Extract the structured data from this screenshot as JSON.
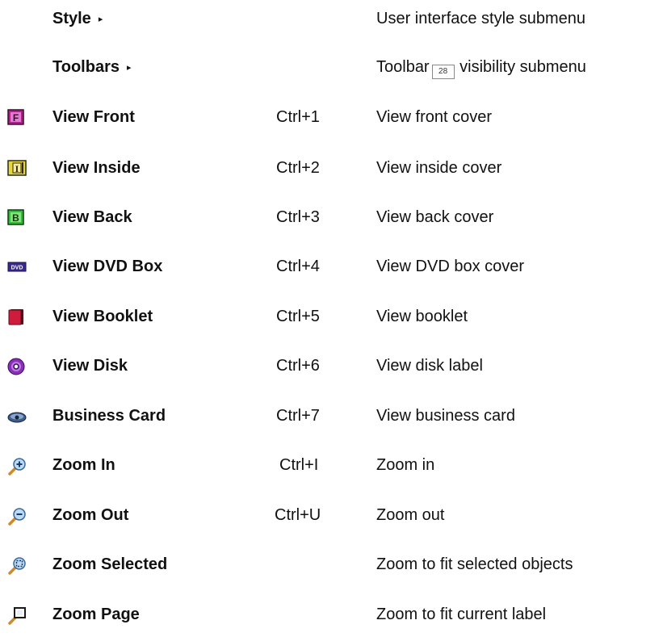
{
  "menu": {
    "items": [
      {
        "name": "Style",
        "arrow": "▸",
        "shortcut": "",
        "description": "User interface style submenu",
        "icon": "none"
      },
      {
        "name": "Toolbars",
        "arrow": "▸",
        "shortcut": "",
        "description_before": "Toolbar",
        "ref": "28",
        "description_after": " visibility submenu",
        "icon": "none"
      },
      {
        "name": "View Front",
        "shortcut": "Ctrl+1",
        "description": "View front cover",
        "icon": "front-cover-icon"
      },
      {
        "name": "View Inside",
        "shortcut": "Ctrl+2",
        "description": "View inside cover",
        "icon": "inside-cover-icon"
      },
      {
        "name": "View Back",
        "shortcut": "Ctrl+3",
        "description": "View back cover",
        "icon": "back-cover-icon"
      },
      {
        "name": "View DVD Box",
        "shortcut": "Ctrl+4",
        "description": "View DVD box cover",
        "icon": "dvd-box-icon",
        "icon_text": "DVD"
      },
      {
        "name": "View Booklet",
        "shortcut": "Ctrl+5",
        "description": "View booklet",
        "icon": "booklet-icon"
      },
      {
        "name": "View Disk",
        "shortcut": "Ctrl+6",
        "description": "View disk label",
        "icon": "disk-icon"
      },
      {
        "name": "Business Card",
        "shortcut": "Ctrl+7",
        "description": "View business card",
        "icon": "business-card-icon"
      },
      {
        "name": "Zoom In",
        "shortcut": "Ctrl+I",
        "description": "Zoom in",
        "icon": "zoom-in-icon"
      },
      {
        "name": "Zoom Out",
        "shortcut": "Ctrl+U",
        "description": "Zoom out",
        "icon": "zoom-out-icon"
      },
      {
        "name": "Zoom Selected",
        "shortcut": "",
        "description": "Zoom to fit selected objects",
        "icon": "zoom-selected-icon"
      },
      {
        "name": "Zoom Page",
        "shortcut": "",
        "description": "Zoom to fit current label",
        "icon": "zoom-page-icon"
      }
    ]
  },
  "colors": {
    "front": "#b0208c",
    "inside": "#e8d640",
    "back": "#2fc03a",
    "dvd": "#3a2a8c",
    "booklet": "#d01c3c",
    "disk": "#8a2fb8",
    "card": "#3f5c8a",
    "magnifier_handle": "#d08a2a",
    "magnifier_lens": "#6aa8e0"
  }
}
